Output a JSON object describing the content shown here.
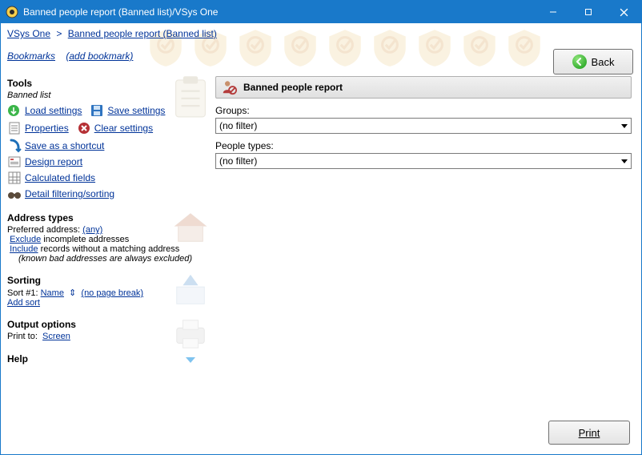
{
  "titlebar": {
    "title": "Banned people report (Banned list)/VSys One"
  },
  "breadcrumb": {
    "root": "VSys One",
    "current": "Banned people report (Banned list)"
  },
  "bookmarks": {
    "label": "Bookmarks",
    "add": "(add bookmark)"
  },
  "buttons": {
    "back": "Back",
    "print": "Print"
  },
  "sidebar": {
    "tools": {
      "heading": "Tools",
      "subtitle": "Banned list",
      "load_settings": "Load settings",
      "save_settings": "Save settings",
      "properties": "Properties",
      "clear_settings": "Clear settings",
      "save_shortcut": "Save as a shortcut",
      "design_report": "Design report",
      "calculated_fields": "Calculated fields",
      "detail_filtering": "Detail filtering/sorting"
    },
    "address": {
      "heading": "Address types",
      "preferred_label": "Preferred address:",
      "preferred_value": "(any)",
      "exclude": "Exclude",
      "exclude_suffix": " incomplete addresses",
      "include": "Include",
      "include_suffix": " records without a matching address",
      "note": "(known bad addresses are always excluded)"
    },
    "sorting": {
      "heading": "Sorting",
      "sort_label": "Sort #1:",
      "sort_value": "Name",
      "sort_opt": "(no page break)",
      "add_sort": "Add sort"
    },
    "output": {
      "heading": "Output options",
      "print_to_label": "Print to:",
      "print_to_value": "Screen"
    },
    "help": {
      "heading": "Help"
    }
  },
  "report": {
    "title": "Banned people report",
    "groups_label": "Groups:",
    "groups_value": "(no filter)",
    "people_types_label": "People types:",
    "people_types_value": "(no filter)"
  }
}
